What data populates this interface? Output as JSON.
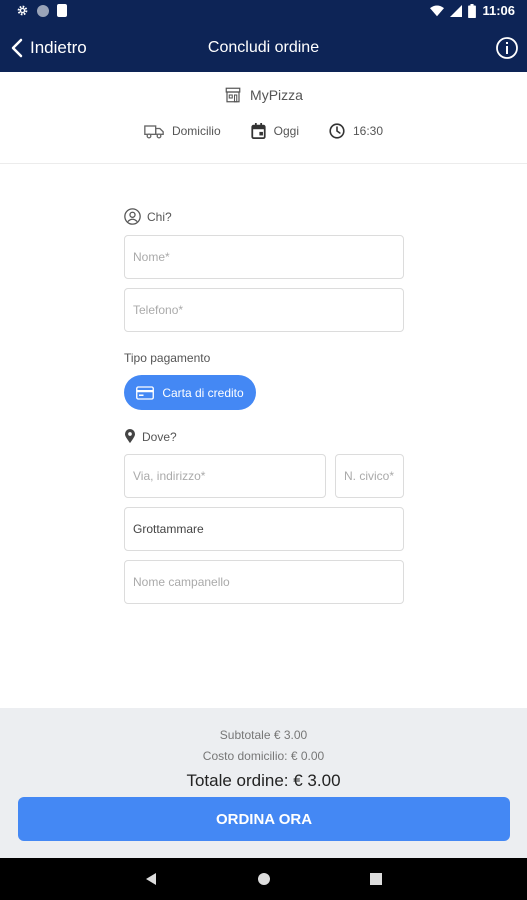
{
  "status_bar": {
    "time": "11:06",
    "icons": [
      "gear-icon",
      "circle-icon",
      "sd-card-icon",
      "wifi-icon",
      "signal-icon",
      "battery-icon"
    ]
  },
  "app_bar": {
    "back_label": "Indietro",
    "title": "Concludi ordine",
    "info_icon": "info-icon"
  },
  "store": {
    "name": "MyPizza",
    "delivery_mode": "Domicilio",
    "day": "Oggi",
    "time": "16:30"
  },
  "form": {
    "who_label": "Chi?",
    "name_placeholder": "Nome*",
    "phone_placeholder": "Telefono*",
    "payment_label": "Tipo pagamento",
    "payment_option": "Carta di credito",
    "where_label": "Dove?",
    "address_placeholder": "Via, indirizzo*",
    "civic_placeholder": "N. civico*",
    "city_value": "Grottammare",
    "bell_placeholder": "Nome campanello"
  },
  "summary": {
    "subtotal": "Subtotale € 3.00",
    "delivery_cost": "Costo domicilio: € 0.00",
    "total": "Totale ordine: € 3.00",
    "order_button": "ORDINA ORA"
  },
  "colors": {
    "header_bg": "#0d2456",
    "accent": "#4488f4",
    "footer_bg": "#eceef1"
  }
}
